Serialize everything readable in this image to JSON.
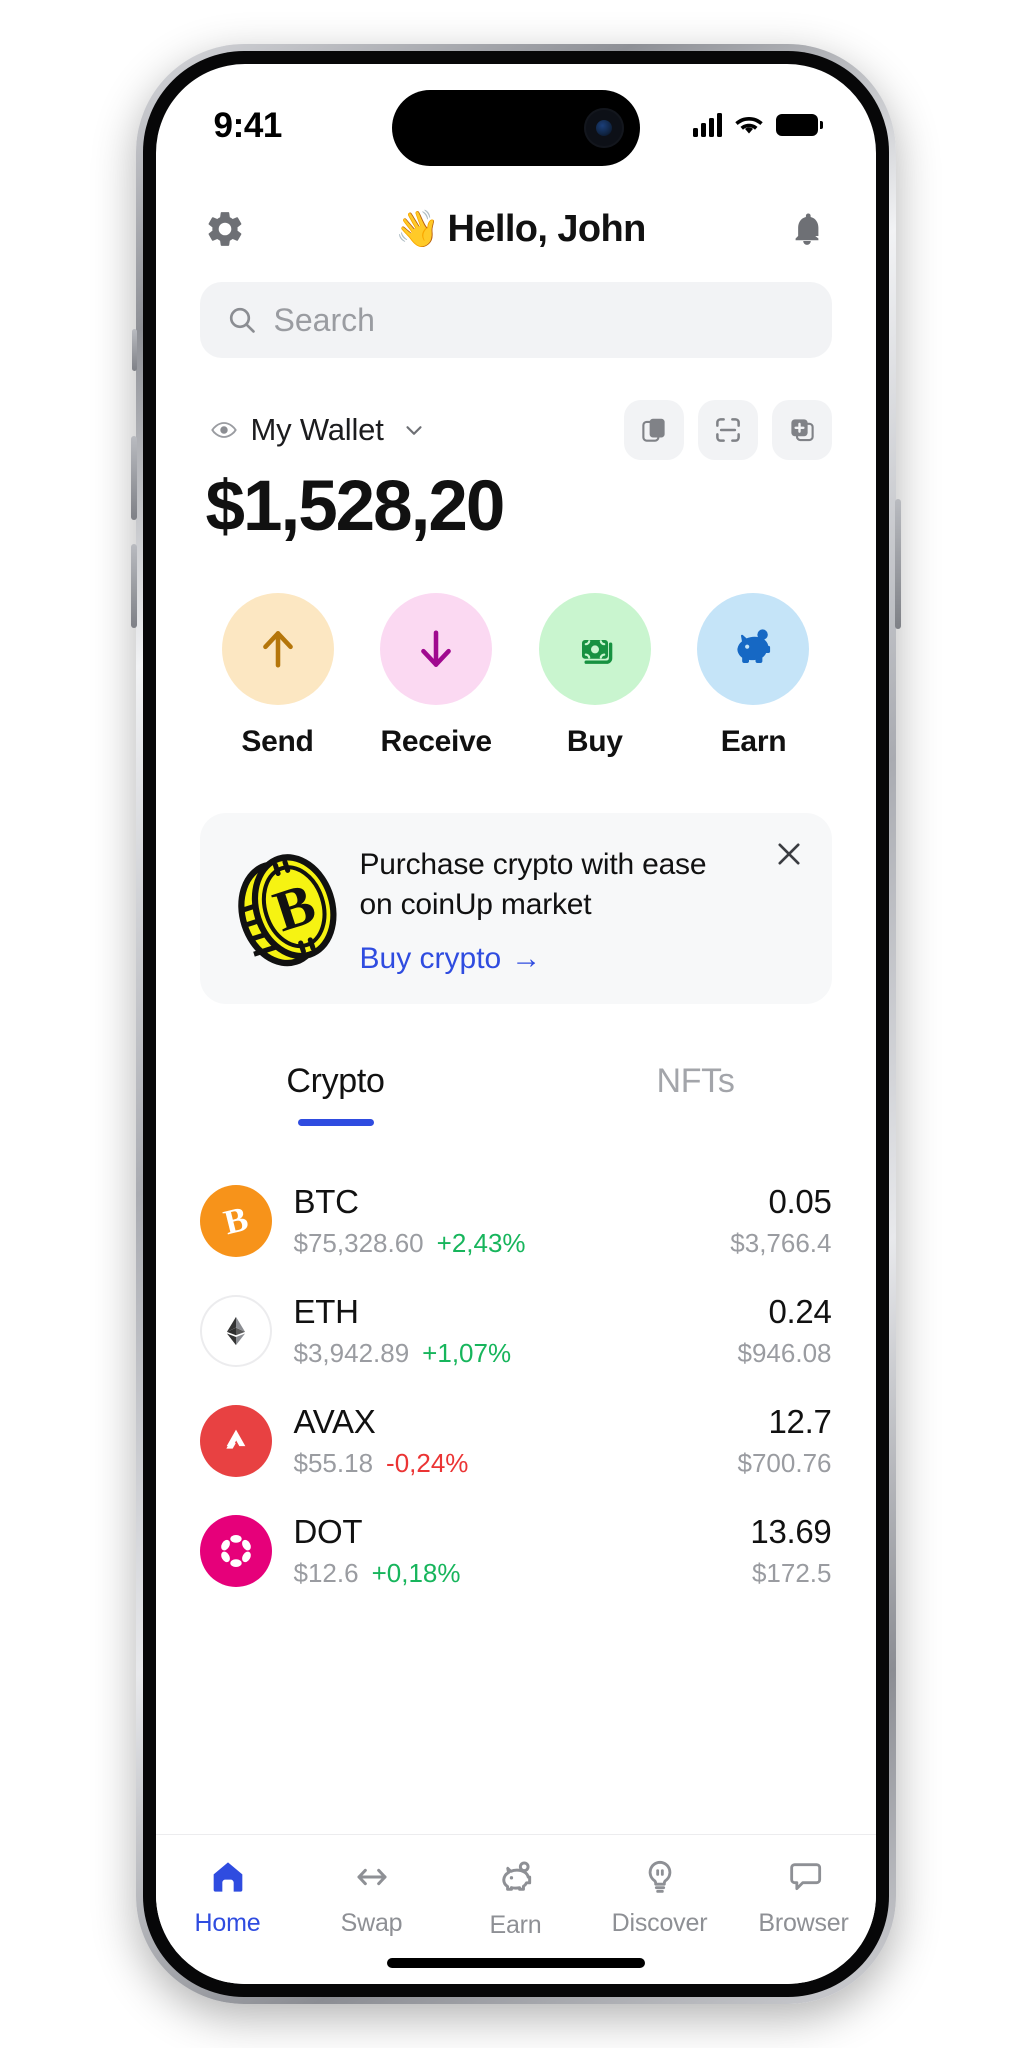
{
  "status_bar": {
    "time": "9:41",
    "signal_icon": "cellular-signal-icon",
    "wifi_icon": "wifi-icon",
    "battery_icon": "battery-icon"
  },
  "header": {
    "settings_icon": "gear-icon",
    "greeting_emoji": "👋",
    "greeting": "Hello, John",
    "notifications_icon": "bell-icon"
  },
  "search": {
    "placeholder": "Search",
    "value": "",
    "icon": "search-icon"
  },
  "wallet": {
    "eye_icon": "eye-icon",
    "name": "My Wallet",
    "chevron_icon": "chevron-down-icon",
    "balance": "$1,528,20",
    "actions": [
      {
        "name": "copy-address-button",
        "icon": "copy-icon"
      },
      {
        "name": "scan-qr-button",
        "icon": "scan-icon"
      },
      {
        "name": "add-wallet-button",
        "icon": "add-card-icon"
      }
    ]
  },
  "quick_actions": [
    {
      "label": "Send",
      "icon": "arrow-up-icon",
      "bg": "#fce7c2",
      "fg": "#b5760a"
    },
    {
      "label": "Receive",
      "icon": "arrow-down-icon",
      "bg": "#fbd9f2",
      "fg": "#a0098f"
    },
    {
      "label": "Buy",
      "icon": "banknotes-icon",
      "bg": "#c9f5cf",
      "fg": "#179141"
    },
    {
      "label": "Earn",
      "icon": "piggy-bank-icon",
      "bg": "#c5e4f8",
      "fg": "#1668c4"
    }
  ],
  "promo": {
    "icon": "bitcoin-coin-icon",
    "title_line1": "Purchase crypto with ease",
    "title_line2": "on coinUp market",
    "cta": "Buy crypto",
    "cta_arrow": "→",
    "close_icon": "close-icon",
    "accent": "#2f4ce0"
  },
  "tabs": [
    {
      "label": "Crypto",
      "active": true
    },
    {
      "label": "NFTs",
      "active": false
    }
  ],
  "tokens": [
    {
      "symbol": "BTC",
      "price": "$75,328.60",
      "change": "+2,43%",
      "direction": "up",
      "amount": "0.05",
      "value": "$3,766.4",
      "icon": "bitcoin-icon",
      "bg": "#f7931a"
    },
    {
      "symbol": "ETH",
      "price": "$3,942.89",
      "change": "+1,07%",
      "direction": "up",
      "amount": "0.24",
      "value": "$946.08",
      "icon": "ethereum-icon",
      "bg": "#ffffff"
    },
    {
      "symbol": "AVAX",
      "price": "$55.18",
      "change": "-0,24%",
      "direction": "down",
      "amount": "12.7",
      "value": "$700.76",
      "icon": "avalanche-icon",
      "bg": "#e84142"
    },
    {
      "symbol": "DOT",
      "price": "$12.6",
      "change": "+0,18%",
      "direction": "up",
      "amount": "13.69",
      "value": "$172.5",
      "icon": "polkadot-icon",
      "bg": "#e6007a"
    }
  ],
  "bottom_nav": [
    {
      "label": "Home",
      "icon": "home-icon",
      "active": true
    },
    {
      "label": "Swap",
      "icon": "swap-icon",
      "active": false
    },
    {
      "label": "Earn",
      "icon": "piggy-bank-icon",
      "active": false
    },
    {
      "label": "Discover",
      "icon": "bulb-icon",
      "active": false
    },
    {
      "label": "Browser",
      "icon": "browser-icon",
      "active": false
    }
  ],
  "colors": {
    "accent": "#2f4ce0",
    "positive": "#17b55c",
    "negative": "#eb3434",
    "muted": "#9a9ca1"
  }
}
